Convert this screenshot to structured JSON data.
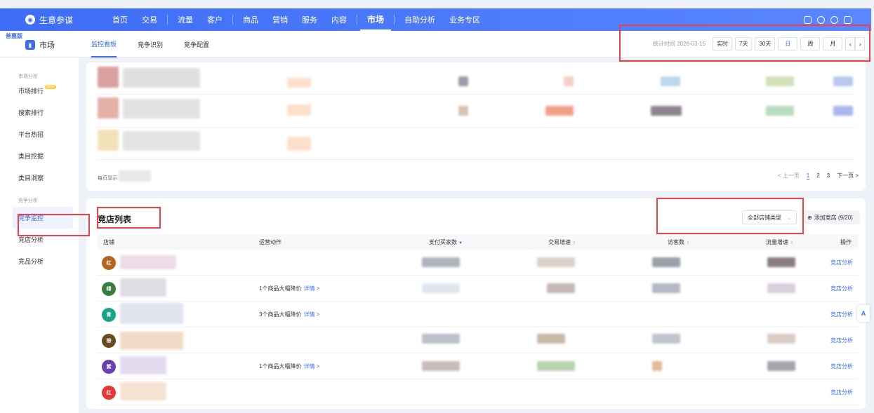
{
  "topnav": {
    "brand": "生意参谋",
    "items": [
      "首页",
      "交易",
      "流量",
      "客户",
      "商品",
      "营销",
      "服务",
      "内容",
      "市场",
      "自助分析",
      "业务专区"
    ],
    "active": "市场"
  },
  "subheader": {
    "edition": "普惠版",
    "section": "市场",
    "tabs": [
      "监控看板",
      "竞争识别",
      "竞争配置"
    ],
    "active_tab": "监控看板",
    "stat_time": "统计时间 2026-03-15",
    "periods": [
      "实时",
      "7天",
      "30天",
      "日",
      "周",
      "月"
    ],
    "active_period": "日"
  },
  "sidebar": {
    "group1": "市场分析",
    "items1": [
      "市场排行",
      "搜索排行",
      "平台热招",
      "类目挖掘",
      "类目洞察"
    ],
    "new_badge": "NEW",
    "group2": "竞争分析",
    "items2": [
      "竞争监控",
      "竞店分析",
      "竞品分析"
    ],
    "active": "竞争监控"
  },
  "top_card": {
    "per_page": "每页显示",
    "pager": {
      "prev": "< 上一页",
      "pages": [
        "1",
        "2",
        "3"
      ],
      "active_page": "1",
      "next": "下一页 >"
    }
  },
  "shop_list": {
    "title": "竞店列表",
    "shop_type": "全部店铺类型",
    "add_shop": "添加竞店 (9/20)",
    "columns": [
      "店铺",
      "运营动作",
      "支付买家数",
      "交易增速",
      "访客数",
      "流量增速",
      "操作"
    ],
    "rows": [
      {
        "logo": "红",
        "logo_color": "#b5651d",
        "op": "",
        "detail": "",
        "action": "竞店分析"
      },
      {
        "logo": "绿",
        "logo_color": "#3a7d44",
        "op": "1个商品大幅降价",
        "detail": "详情 >",
        "action": "竞店分析"
      },
      {
        "logo": "青",
        "logo_color": "#1aa38a",
        "op": "3个商品大幅降价",
        "detail": "详情 >",
        "action": "竞店分析"
      },
      {
        "logo": "棕",
        "logo_color": "#6b4a1e",
        "op": "",
        "detail": "",
        "action": "竞店分析"
      },
      {
        "logo": "紫",
        "logo_color": "#6a3fb3",
        "op": "1个商品大幅降价",
        "detail": "详情 >",
        "action": "竞店分析"
      },
      {
        "logo": "红",
        "logo_color": "#e53935",
        "op": "",
        "detail": "",
        "action": "竞店分析"
      }
    ]
  },
  "colors": {
    "primary": "#3d6df6",
    "highlight": "#e8424b"
  }
}
